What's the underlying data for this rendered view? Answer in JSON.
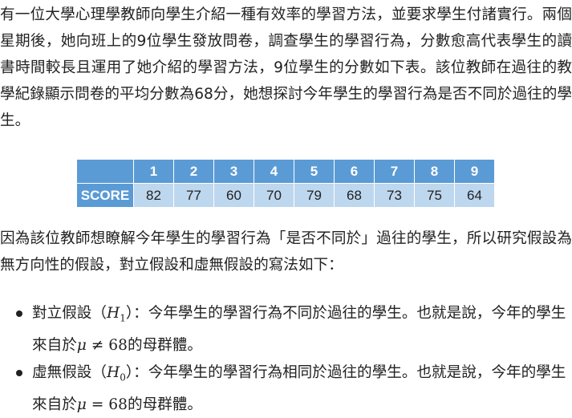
{
  "intro": "有一位大學心理學教師向學生介紹一種有效率的學習方法，並要求學生付諸實行。兩個星期後，她向班上的9位學生發放問卷，調查學生的學習行為，分數愈高代表學生的讀書時間較長且運用了她介紹的學習方法，9位學生的分數如下表。該位教師在過往的教學紀錄顯示問卷的平均分數為68分，她想探討今年學生的學習行為是否不同於過往的學生。",
  "table": {
    "headers": [
      "",
      "1",
      "2",
      "3",
      "4",
      "5",
      "6",
      "7",
      "8",
      "9"
    ],
    "row_label": "SCORE",
    "scores": [
      "82",
      "77",
      "60",
      "70",
      "79",
      "68",
      "73",
      "75",
      "64"
    ]
  },
  "para2": "因為該位教師想瞭解今年學生的學習行為「是否不同於」過往的學生，所以研究假設為無方向性的假設，對立假設和虛無假設的寫法如下：",
  "bullets": [
    {
      "name": "對立假設（",
      "sym": "H",
      "sub": "1",
      "close": "）",
      "text": "：今年學生的學習行為不同於過往的學生。也就是說，今年的學生來自於",
      "mu": "μ",
      "op": " ≠ ",
      "value": "68",
      "tail": "的母群體。"
    },
    {
      "name": "虛無假設（",
      "sym": "H",
      "sub": "0",
      "close": "）",
      "text": "：今年學生的學習行為相同於過往的學生。也就是說，今年的學生來自於",
      "mu": "μ",
      "op": " = ",
      "value": "68",
      "tail": "的母群體。"
    }
  ]
}
